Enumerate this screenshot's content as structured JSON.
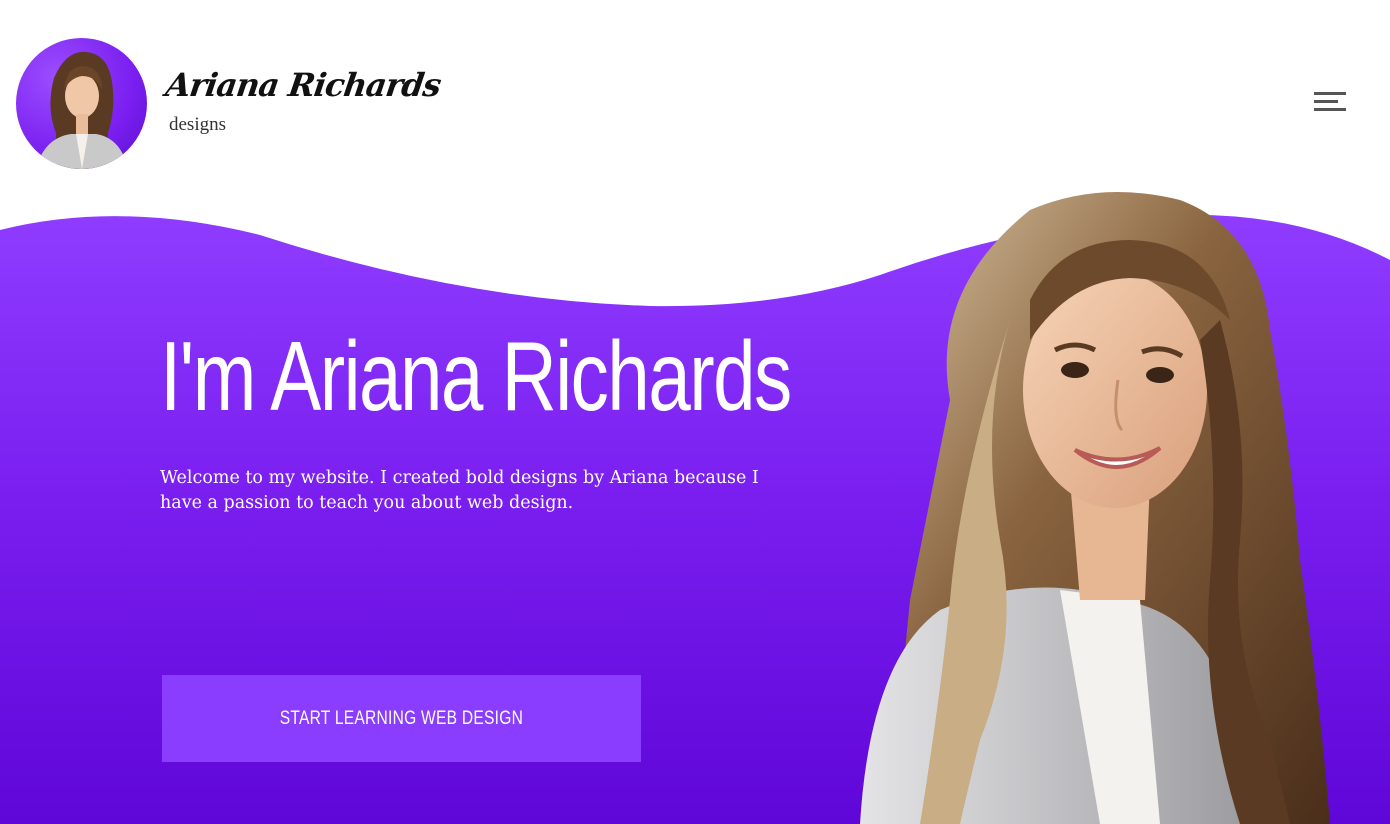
{
  "brand": {
    "name": "Ariana Richards",
    "tagline": "designs"
  },
  "hero": {
    "title": "I'm Ariana Richards",
    "description": "Welcome to my website. I created bold designs by Ariana because I have a passion to teach you about web design.",
    "cta_label": "START LEARNING WEB DESIGN"
  },
  "icons": {
    "menu": "hamburger-menu-icon"
  },
  "colors": {
    "accent": "#7a1ff0",
    "accent_dark": "#5f06d8",
    "button": "#8a3cff",
    "text_on_accent": "#ffffff"
  }
}
